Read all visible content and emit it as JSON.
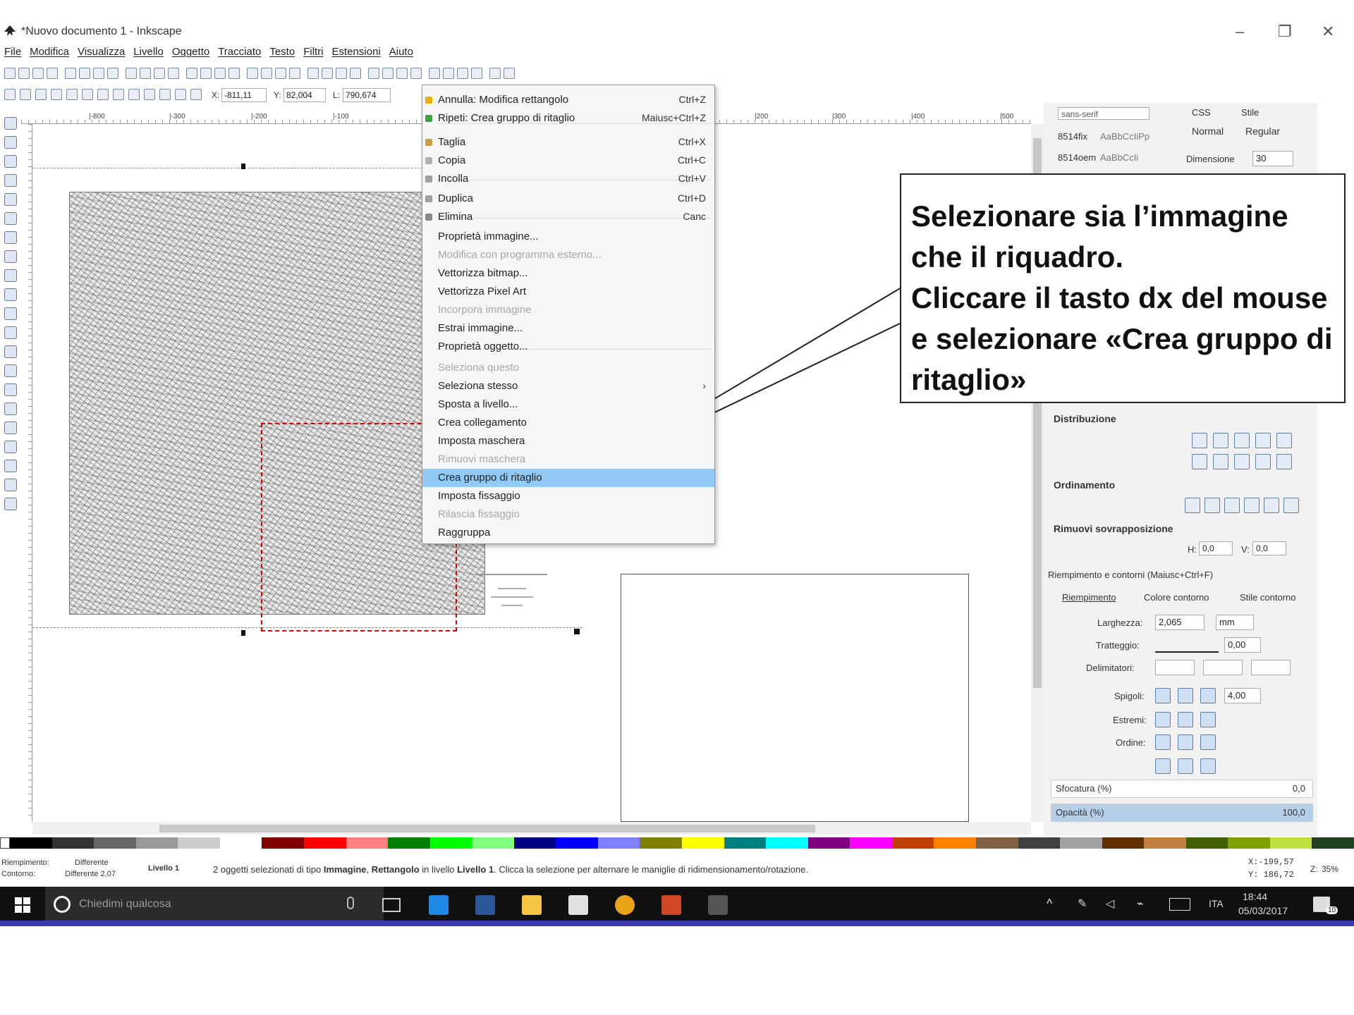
{
  "window": {
    "title": "*Nuovo documento 1 - Inkscape",
    "minimize": "–",
    "restore": "❐",
    "close": "✕"
  },
  "menubar": [
    "File",
    "Modifica",
    "Visualizza",
    "Livello",
    "Oggetto",
    "Tracciato",
    "Testo",
    "Filtri",
    "Estensioni",
    "Aiuto"
  ],
  "toolctrl": {
    "x_label": "X:",
    "x_value": "-811,11",
    "y_label": "Y:",
    "y_value": "82,004",
    "w_label": "L:",
    "w_value": "790,674"
  },
  "rulers": [
    "|-800",
    "|-300",
    "|-200",
    "|-100",
    "|200",
    "|300",
    "|400",
    "|500"
  ],
  "context_menu": {
    "items": [
      {
        "label": "Annulla: Modifica rettangolo",
        "shortcut": "Ctrl+Z",
        "disabled": false
      },
      {
        "label": "Ripeti: Crea gruppo di ritaglio",
        "shortcut": "Maiusc+Ctrl+Z",
        "disabled": false
      },
      {
        "label": "Taglia",
        "shortcut": "Ctrl+X",
        "disabled": false
      },
      {
        "label": "Copia",
        "shortcut": "Ctrl+C",
        "disabled": false
      },
      {
        "label": "Incolla",
        "shortcut": "Ctrl+V",
        "disabled": false
      },
      {
        "label": "Duplica",
        "shortcut": "Ctrl+D",
        "disabled": false
      },
      {
        "label": "Elimina",
        "shortcut": "Canc",
        "disabled": false
      },
      {
        "label": "Proprietà immagine...",
        "shortcut": "",
        "disabled": false
      },
      {
        "label": "Modifica con programma esterno...",
        "shortcut": "",
        "disabled": true
      },
      {
        "label": "Vettorizza bitmap...",
        "shortcut": "",
        "disabled": false
      },
      {
        "label": "Vettorizza Pixel Art",
        "shortcut": "",
        "disabled": false
      },
      {
        "label": "Incorpora immagine",
        "shortcut": "",
        "disabled": true
      },
      {
        "label": "Estrai immagine...",
        "shortcut": "",
        "disabled": false
      },
      {
        "label": "Proprietà oggetto...",
        "shortcut": "",
        "disabled": false
      },
      {
        "label": "Seleziona questo",
        "shortcut": "",
        "disabled": true
      },
      {
        "label": "Seleziona stesso",
        "shortcut": "›",
        "disabled": false
      },
      {
        "label": "Sposta a livello...",
        "shortcut": "",
        "disabled": false
      },
      {
        "label": "Crea collegamento",
        "shortcut": "",
        "disabled": false
      },
      {
        "label": "Imposta maschera",
        "shortcut": "",
        "disabled": false
      },
      {
        "label": "Rimuovi maschera",
        "shortcut": "",
        "disabled": true
      },
      {
        "label": "Crea gruppo di ritaglio",
        "shortcut": "",
        "disabled": false
      },
      {
        "label": "Imposta fissaggio",
        "shortcut": "",
        "disabled": false
      },
      {
        "label": "Rilascia fissaggio",
        "shortcut": "",
        "disabled": true
      },
      {
        "label": "Raggruppa",
        "shortcut": "",
        "disabled": false
      }
    ],
    "highlighted": "Crea gruppo di ritaglio"
  },
  "callout": {
    "text": "Selezionare sia l’immagine che il riquadro.\nCliccare il tasto dx del mouse e selezionare «Crea gruppo di ritaglio»"
  },
  "panel": {
    "font_top": "sans-serif",
    "font_rows": [
      {
        "name": "8514fix",
        "sample": "AaBbCcIiPp"
      },
      {
        "name": "8514oem",
        "sample": "AaBbCcIi"
      }
    ],
    "css_label": "CSS",
    "style_label": "Stile",
    "style_normal": "Normal",
    "style_regular": "Regular",
    "size_label": "Dimensione",
    "size_value": "30",
    "distribuzione": "Distribuzione",
    "ordinamento": "Ordinamento",
    "rimuovi": "Rimuovi sovrapposizione",
    "h_label": "H:",
    "h_value": "0,0",
    "v_label": "V:",
    "v_value": "0,0",
    "fill_stroke_title": "Riempimento e contorni (Maiusc+Ctrl+F)",
    "tabs": [
      "Riempimento",
      "Colore contorno",
      "Stile contorno"
    ],
    "larghezza_label": "Larghezza:",
    "larghezza_value": "2,065",
    "unit": "mm",
    "tratteggio_label": "Tratteggio:",
    "tratteggio_value": "0,00",
    "delimitatori_label": "Delimitatori:",
    "spigoli_label": "Spigoli:",
    "spigoli_value": "4,00",
    "estremi_label": "Estremi:",
    "ordine_label": "Ordine:",
    "sfocatura_label": "Sfocatura (%)",
    "sfocatura_value": "0,0",
    "opacita_label": "Opacità (%)",
    "opacita_value": "100,0"
  },
  "status": {
    "fill_label": "Riempimento:",
    "fill_value": "Differente",
    "stroke_label": "Contorno:",
    "stroke_value": "Differente 2,07",
    "layer": "Livello 1",
    "message_pre": "2 oggetti selezionati di tipo ",
    "message_b1": "Immagine",
    "message_mid1": ", ",
    "message_b2": "Rettangolo",
    "message_mid2": " in livello ",
    "message_b3": "Livello 1",
    "message_post": ". Clicca la selezione per alternare le maniglie di ridimensionamento/rotazione.",
    "coord_x": "X:-199,57",
    "coord_y": "Y: 186,72",
    "zoom_label": "Z:",
    "zoom": "35%"
  },
  "taskbar": {
    "search_placeholder": "Chiedimi qualcosa",
    "lang": "ITA",
    "time": "18:44",
    "date": "05/03/2017",
    "notif": "10"
  },
  "palette_colors": [
    "#000000",
    "#333333",
    "#666666",
    "#999999",
    "#cccccc",
    "#ffffff",
    "#800000",
    "#ff0000",
    "#ff8080",
    "#008000",
    "#00ff00",
    "#80ff80",
    "#000080",
    "#0000ff",
    "#8080ff",
    "#808000",
    "#ffff00",
    "#008080",
    "#00ffff",
    "#800080",
    "#ff00ff",
    "#c04000",
    "#ff8000",
    "#806040",
    "#404040",
    "#a0a0a0",
    "#603000",
    "#c08040",
    "#406000",
    "#80a000",
    "#c0e040",
    "#204020"
  ]
}
